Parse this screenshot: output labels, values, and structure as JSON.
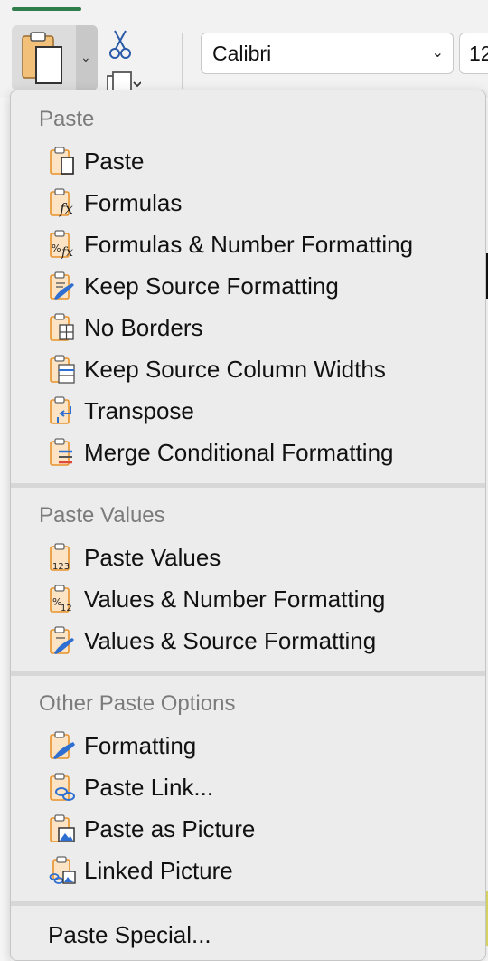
{
  "ribbon": {
    "font_name": "Calibri",
    "font_size": "12"
  },
  "menu": {
    "sections": [
      {
        "header": "Paste",
        "items": [
          {
            "label": "Paste",
            "icon": "paste-icon"
          },
          {
            "label": "Formulas",
            "icon": "paste-formulas-icon"
          },
          {
            "label": "Formulas & Number Formatting",
            "icon": "paste-formulas-number-icon"
          },
          {
            "label": "Keep Source Formatting",
            "icon": "paste-keep-source-icon"
          },
          {
            "label": "No Borders",
            "icon": "paste-no-borders-icon"
          },
          {
            "label": "Keep Source Column Widths",
            "icon": "paste-column-widths-icon"
          },
          {
            "label": "Transpose",
            "icon": "paste-transpose-icon"
          },
          {
            "label": "Merge Conditional Formatting",
            "icon": "paste-merge-conditional-icon"
          }
        ]
      },
      {
        "header": "Paste Values",
        "items": [
          {
            "label": "Paste Values",
            "icon": "paste-values-icon"
          },
          {
            "label": "Values & Number Formatting",
            "icon": "paste-values-number-icon"
          },
          {
            "label": "Values & Source Formatting",
            "icon": "paste-values-source-icon"
          }
        ]
      },
      {
        "header": "Other Paste Options",
        "items": [
          {
            "label": "Formatting",
            "icon": "paste-formatting-icon"
          },
          {
            "label": "Paste Link...",
            "icon": "paste-link-icon"
          },
          {
            "label": "Paste as Picture",
            "icon": "paste-picture-icon"
          },
          {
            "label": "Linked Picture",
            "icon": "linked-picture-icon"
          }
        ]
      }
    ],
    "paste_special": "Paste Special..."
  },
  "colors": {
    "clipboard_orange": "#e8922a",
    "accent_blue": "#2f6fd1",
    "menu_bg": "#ececec",
    "header_gray": "#7b7b7b",
    "tab_green": "#2e7d4a"
  }
}
